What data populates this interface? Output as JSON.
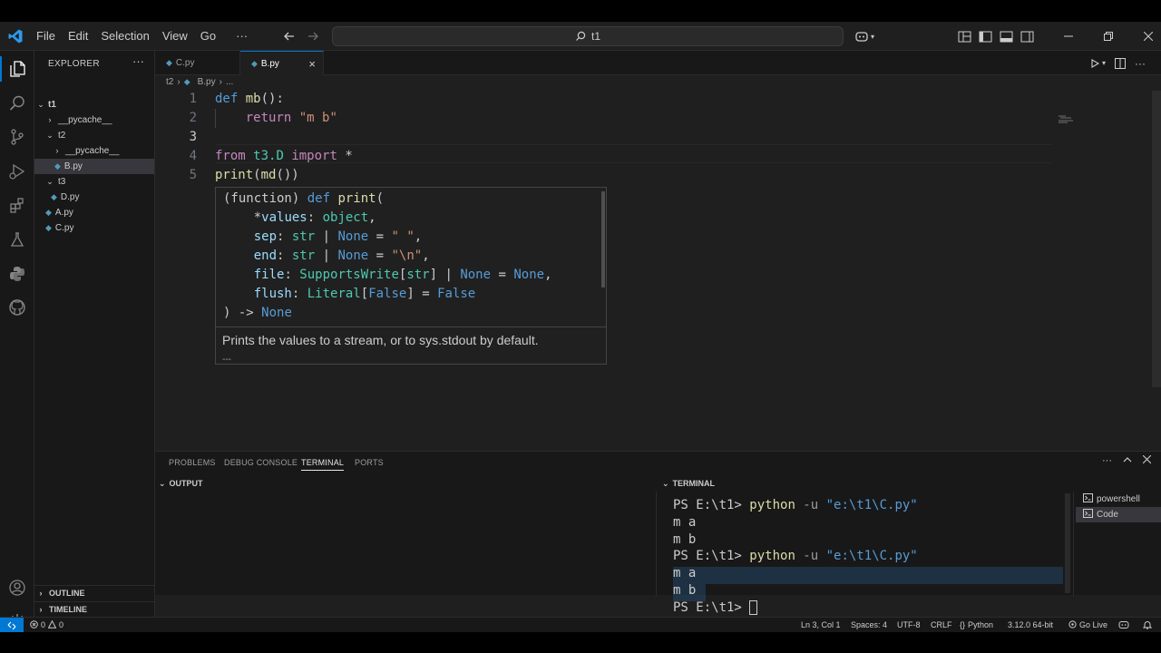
{
  "menu": {
    "file": "File",
    "edit": "Edit",
    "selection": "Selection",
    "view": "View",
    "go": "Go",
    "more": "···"
  },
  "search": {
    "text": "t1"
  },
  "explorer": {
    "title": "EXPLORER",
    "more": "···",
    "root": "t1",
    "items": [
      {
        "label": "__pycache__"
      },
      {
        "label": "t2"
      },
      {
        "label": "__pycache__"
      },
      {
        "label": "B.py"
      },
      {
        "label": "t3"
      },
      {
        "label": "D.py"
      },
      {
        "label": "A.py"
      },
      {
        "label": "C.py"
      }
    ],
    "outline": "OUTLINE",
    "timeline": "TIMELINE"
  },
  "tabs": [
    {
      "label": "C.py"
    },
    {
      "label": "B.py",
      "close": "×"
    }
  ],
  "breadcrumb": {
    "folder": "t2",
    "file": "B.py",
    "rest": "..."
  },
  "editor": {
    "line_numbers": [
      "1",
      "2",
      "3",
      "4",
      "5"
    ],
    "lines": {
      "l1": {
        "kw": "def",
        "fn": "mb",
        "rest": "():"
      },
      "l2": {
        "kw": "return",
        "str": "\"m b\""
      },
      "l4": {
        "from": "from",
        "mod": "t3.D",
        "imp": "import",
        "star": "*"
      },
      "l5": {
        "fn": "print",
        "p1": "(",
        "fn2": "md",
        "rest": "())"
      }
    }
  },
  "hover": {
    "lines": {
      "h1": {
        "a": "(function) ",
        "kw": "def",
        "fn": " print",
        "b": "("
      },
      "h2": {
        "a": "    *",
        "p": "values",
        "b": ": ",
        "t": "object",
        "c": ","
      },
      "h3": {
        "a": "    ",
        "p": "sep",
        "b": ": ",
        "t": "str",
        "c": " | ",
        "n": "None",
        "d": " = ",
        "s": "\" \"",
        "e": ","
      },
      "h4": {
        "a": "    ",
        "p": "end",
        "b": ": ",
        "t": "str",
        "c": " | ",
        "n": "None",
        "d": " = ",
        "s": "\"\\n\"",
        "e": ","
      },
      "h5": {
        "a": "    ",
        "p": "file",
        "b": ": ",
        "t": "SupportsWrite",
        "c": "[",
        "t2": "str",
        "d": "] | ",
        "n": "None",
        "e": " = ",
        "n2": "None",
        "f": ","
      },
      "h6": {
        "a": "    ",
        "p": "flush",
        "b": ": ",
        "t": "Literal",
        "c": "[",
        "n": "False",
        "d": "] = ",
        "n2": "False"
      },
      "h7": {
        "a": ") -> ",
        "n": "None"
      }
    },
    "doc": "Prints the values to a stream, or to sys.stdout by default.",
    "more": "---"
  },
  "panel": {
    "tabs": [
      "PROBLEMS",
      "DEBUG CONSOLE",
      "TERMINAL",
      "PORTS"
    ],
    "output_header": "OUTPUT",
    "terminal_header": "TERMINAL",
    "terminal_lines": {
      "t1": {
        "ps": "PS E:\\t1> ",
        "cmd": "python",
        "flag": " -u ",
        "path": "\"e:\\t1\\C.py\""
      },
      "t2": "m a",
      "t3": "m b",
      "t4": {
        "ps": "PS E:\\t1> ",
        "cmd": "python",
        "flag": " -u ",
        "path": "\"e:\\t1\\C.py\""
      },
      "t5": "m a",
      "t6": "m b",
      "t7": {
        "ps": "PS E:\\t1> "
      }
    },
    "terminals": [
      {
        "label": "powershell"
      },
      {
        "label": "Code"
      }
    ]
  },
  "statusbar": {
    "errors": "0",
    "warnings": "0",
    "position": "Ln 3, Col 1",
    "spaces": "Spaces: 4",
    "encoding": "UTF-8",
    "eol": "CRLF",
    "language": "Python",
    "version": "3.12.0 64-bit",
    "golive": "Go Live"
  },
  "colors": {
    "accent": "#0078d4",
    "keyword": "#569cd6",
    "control": "#c586c0",
    "function": "#dcdcaa",
    "string": "#ce9178",
    "type": "#4ec9b0",
    "param": "#9cdcfe"
  }
}
